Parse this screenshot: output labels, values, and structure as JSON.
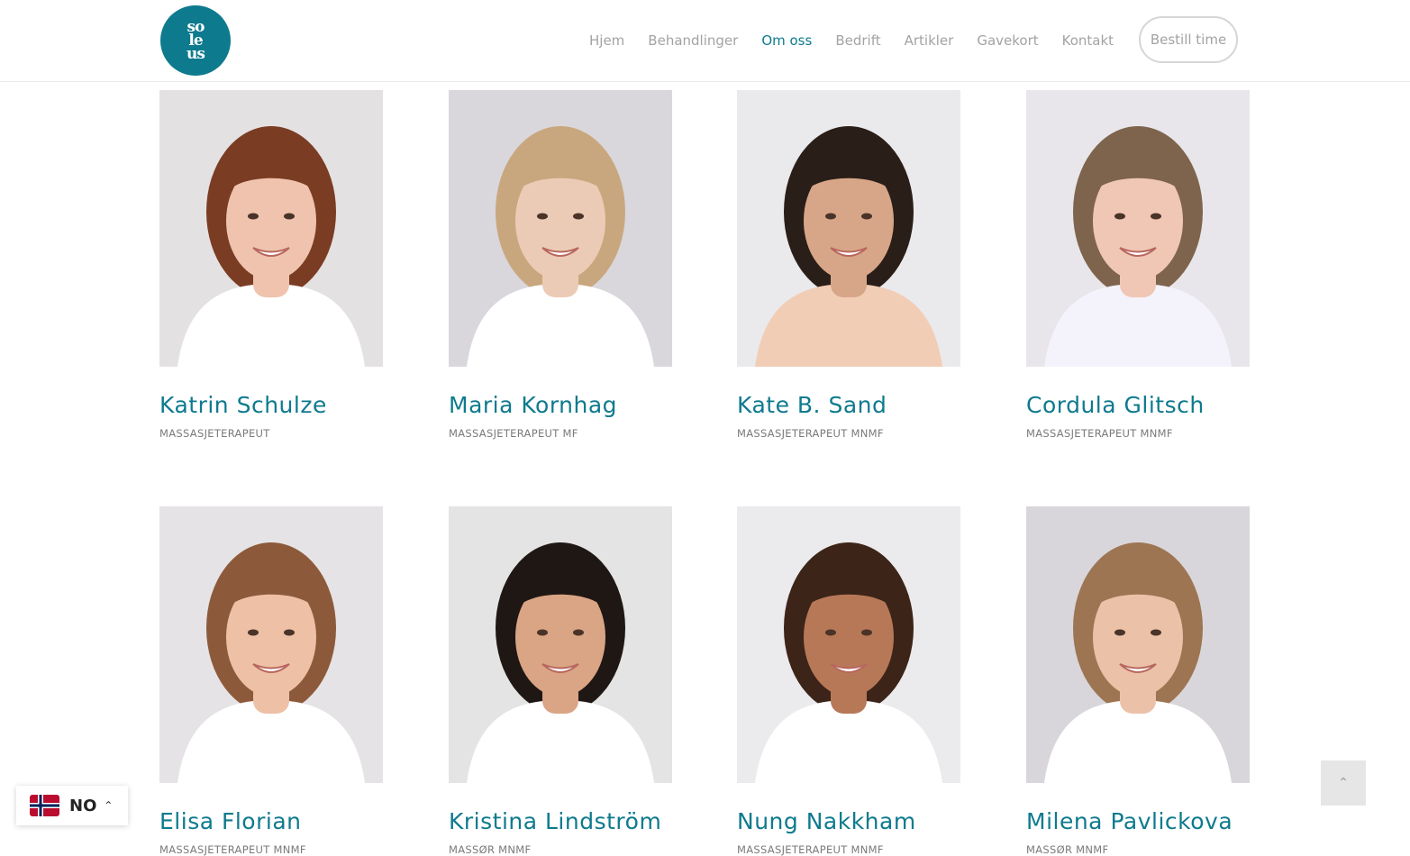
{
  "header": {
    "logo_lines": [
      "so",
      "le",
      "us"
    ],
    "nav": [
      {
        "label": "Hjem",
        "active": false
      },
      {
        "label": "Behandlinger",
        "active": false
      },
      {
        "label": "Om oss",
        "active": true
      },
      {
        "label": "Bedrift",
        "active": false
      },
      {
        "label": "Artikler",
        "active": false
      },
      {
        "label": "Gavekort",
        "active": false
      },
      {
        "label": "Kontakt",
        "active": false
      }
    ],
    "cta_label": "Bestill time"
  },
  "team": [
    {
      "name": "Katrin Schulze",
      "title": "MASSASJETERAPEUT",
      "hair": "#7a3c22",
      "shirt": "#ffffff",
      "bg": "#e4e1e3",
      "skin": "#efc3ad"
    },
    {
      "name": "Maria Kornhag",
      "title": "MASSASJETERAPEUT MF",
      "hair": "#c9a77e",
      "shirt": "#ffffff",
      "bg": "#d9d7dc",
      "skin": "#eccbb6"
    },
    {
      "name": "Kate B. Sand",
      "title": "MASSASJETERAPEUT MNMF",
      "hair": "#2a1e18",
      "shirt": "#f2cdb6",
      "bg": "#eaeaec",
      "skin": "#d7a688"
    },
    {
      "name": "Cordula Glitsch",
      "title": "MASSASJETERAPEUT MNMF",
      "hair": "#7e644c",
      "shirt": "#f4f2fb",
      "bg": "#e8e6ea",
      "skin": "#f0c6b4"
    },
    {
      "name": "Elisa Florian",
      "title": "MASSASJETERAPEUT MNMF",
      "hair": "#8c5a3a",
      "shirt": "#ffffff",
      "bg": "#e5e3e5",
      "skin": "#eec0a6"
    },
    {
      "name": "Kristina Lindström",
      "title": "MASSØR MNMF",
      "hair": "#1f1714",
      "shirt": "#ffffff",
      "bg": "#e4e4e4",
      "skin": "#d9a585"
    },
    {
      "name": "Nung Nakkham",
      "title": "MASSASJETERAPEUT MNMF",
      "hair": "#3c2418",
      "shirt": "#ffffff",
      "bg": "#ebeaec",
      "skin": "#b77858"
    },
    {
      "name": "Milena Pavlickova",
      "title": "MASSØR MNMF",
      "hair": "#9d7552",
      "shirt": "#ffffff",
      "bg": "#d8d6da",
      "skin": "#ebc1a8"
    }
  ],
  "language": {
    "code": "NO"
  },
  "colors": {
    "accent": "#0e7a8e",
    "nav_inactive": "#a3a3a3"
  },
  "icons": {
    "scroll_top": "chevron-up-icon",
    "lang_caret": "chevron-up-icon",
    "flag": "norway-flag-icon"
  }
}
